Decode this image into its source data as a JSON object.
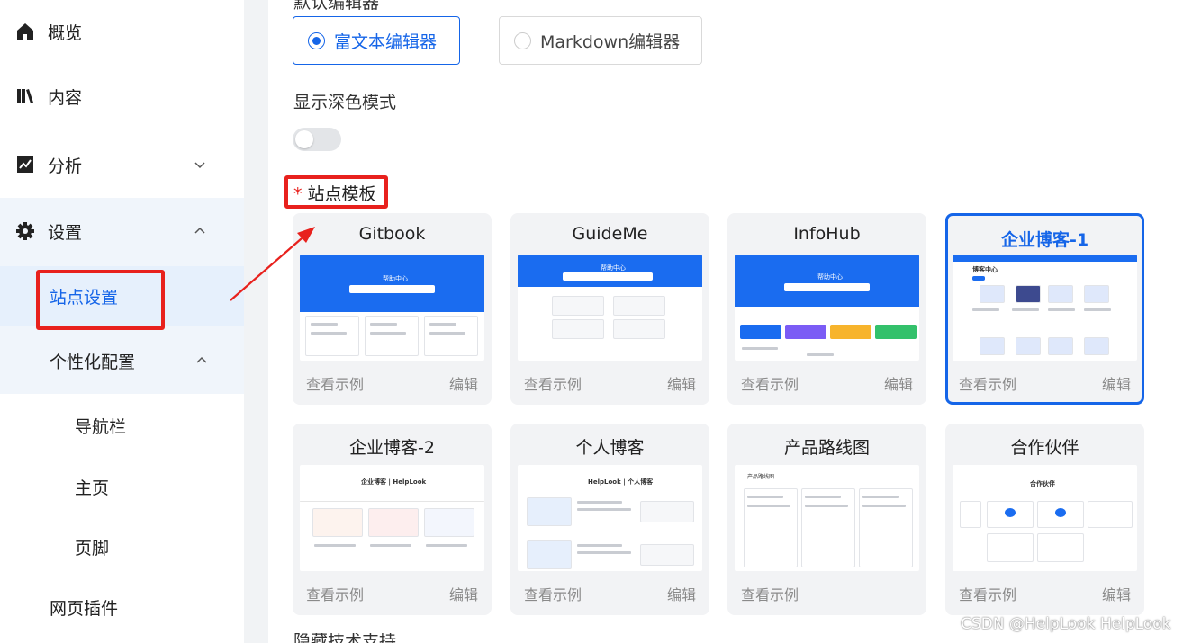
{
  "sidebar": {
    "items": [
      {
        "label": "概览",
        "icon": "home-icon"
      },
      {
        "label": "内容",
        "icon": "book-icon"
      },
      {
        "label": "分析",
        "icon": "chart-icon"
      },
      {
        "label": "设置",
        "icon": "gear-icon"
      }
    ],
    "sub_items": {
      "site_settings": "站点设置",
      "personalization": "个性化配置",
      "navbar": "导航栏",
      "homepage": "主页",
      "footer": "页脚",
      "plugins": "网页插件"
    }
  },
  "editor": {
    "section_title": "默认编辑器",
    "options": [
      "富文本编辑器",
      "Markdown编辑器"
    ],
    "selected": "富文本编辑器"
  },
  "dark_mode": {
    "label": "显示深色模式",
    "enabled": false
  },
  "templates": {
    "label": "站点模板",
    "required_mark": "*",
    "view_label": "查看示例",
    "edit_label": "编辑",
    "selected": "企业博客-1",
    "cards": [
      {
        "name": "Gitbook",
        "thumb_title": "帮助中心"
      },
      {
        "name": "GuideMe",
        "thumb_title": "帮助中心"
      },
      {
        "name": "InfoHub",
        "thumb_title": "帮助中心"
      },
      {
        "name": "企业博客-1",
        "thumb_title": "博客中心"
      },
      {
        "name": "企业博客-2",
        "thumb_title": "企业博客 | HelpLook"
      },
      {
        "name": "个人博客",
        "thumb_title": "HelpLook | 个人博客"
      },
      {
        "name": "产品路线图",
        "thumb_title": "产品路线图"
      },
      {
        "name": "合作伙伴",
        "thumb_title": "合作伙伴"
      }
    ]
  },
  "next_section": "隐藏技术支持",
  "watermark": "CSDN @HelpLook HelpLook",
  "colors": {
    "accent": "#1565e8",
    "highlight": "#e8211d"
  }
}
